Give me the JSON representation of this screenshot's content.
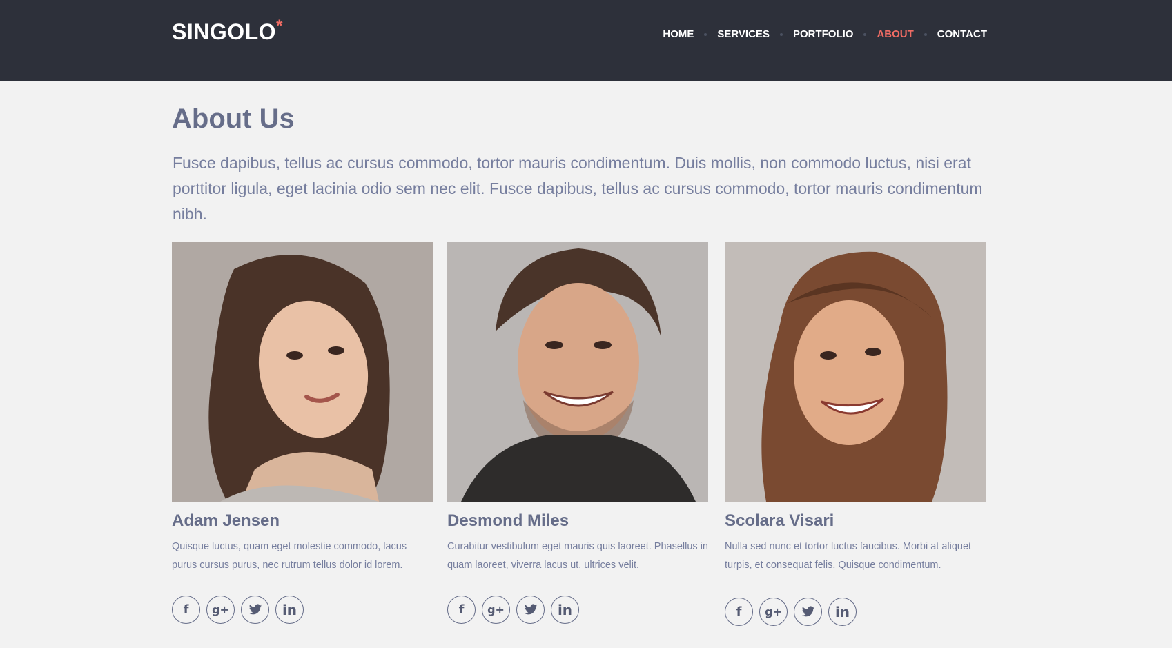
{
  "header": {
    "logo_text": "SINGOLO",
    "logo_mark": "*",
    "nav": [
      {
        "label": "HOME",
        "active": false
      },
      {
        "label": "SERVICES",
        "active": false
      },
      {
        "label": "PORTFOLIO",
        "active": false
      },
      {
        "label": "ABOUT",
        "active": true
      },
      {
        "label": "CONTACT",
        "active": false
      }
    ]
  },
  "about": {
    "title": "About Us",
    "intro": "Fusce dapibus, tellus ac cursus commodo, tortor mauris condimentum. Duis mollis, non commodo luctus, nisi erat porttitor ligula, eget lacinia odio sem nec elit. Fusce dapibus, tellus ac cursus commodo, tortor mauris condimentum nibh."
  },
  "team": [
    {
      "name": "Adam Jensen",
      "description": "Quisque luctus, quam eget molestie commodo, lacus purus cursus purus, nec rutrum tellus dolor id lorem.",
      "photo": "woman-long-dark-hair-portrait"
    },
    {
      "name": "Desmond Miles",
      "description": "Curabitur vestibulum eget mauris quis laoreet. Phasellus in quam laoreet, viverra lacus ut, ultrices velit.",
      "photo": "smiling-man-portrait"
    },
    {
      "name": "Scolara Visari",
      "description": "Nulla sed nunc et tortor luctus faucibus. Morbi at aliquet turpis, et consequat felis. Quisque condimentum.",
      "photo": "smiling-woman-brown-hair-portrait"
    }
  ],
  "social_icons": [
    "facebook-icon",
    "google-plus-icon",
    "twitter-icon",
    "linkedin-icon"
  ],
  "colors": {
    "header_bg": "#2d303a",
    "accent": "#f06c64",
    "heading": "#666d89",
    "body_text": "#767e9e",
    "page_bg": "#f2f2f2"
  }
}
